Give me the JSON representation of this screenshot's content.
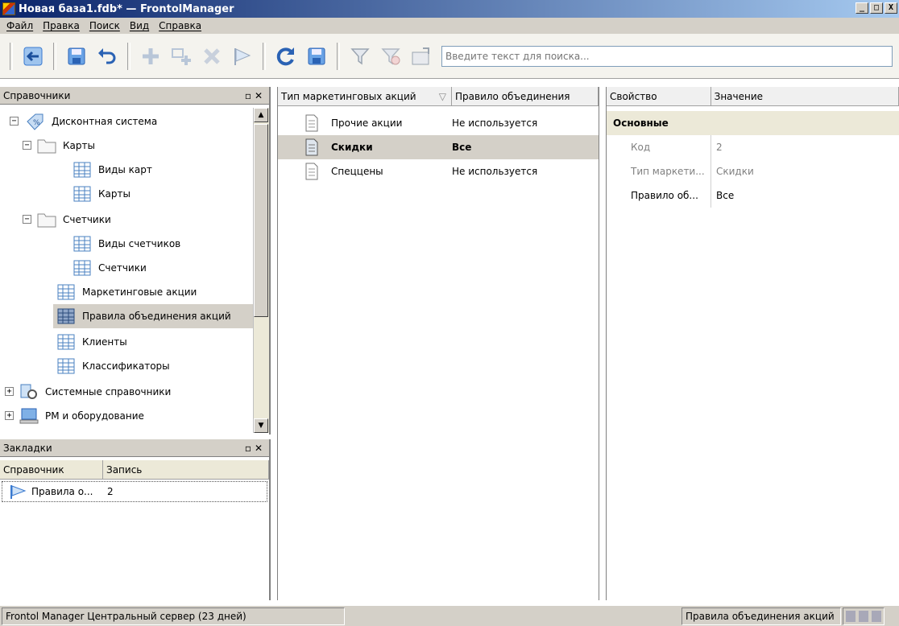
{
  "window": {
    "title": "Новая база1.fdb* — FrontolManager",
    "min_label": "_",
    "max_label": "□",
    "close_label": "X"
  },
  "menu": [
    "Файл",
    "Правка",
    "Поиск",
    "Вид",
    "Справка"
  ],
  "toolbar": {
    "search_placeholder": "Введите текст для поиска...",
    "buttons": [
      "back-arrow-icon",
      "save-icon",
      "undo-icon",
      "add-icon",
      "copy-add-icon",
      "delete-icon",
      "bookmark-flag-icon",
      "refresh-icon",
      "save-all-icon",
      "filter-icon",
      "filter-clear-icon",
      "export-icon"
    ]
  },
  "tree_panel": {
    "title": "Справочники",
    "items": [
      {
        "label": "Дисконтная система",
        "expander": "−"
      },
      {
        "label": "Карты",
        "expander": "−"
      },
      {
        "label": "Виды карт"
      },
      {
        "label": "Карты"
      },
      {
        "label": "Счетчики",
        "expander": "−"
      },
      {
        "label": "Виды счетчиков"
      },
      {
        "label": "Счетчики"
      },
      {
        "label": "Маркетинговые акции"
      },
      {
        "label": "Правила объединения акций"
      },
      {
        "label": "Клиенты"
      },
      {
        "label": "Классификаторы"
      },
      {
        "label": "Системные справочники",
        "expander": "+"
      },
      {
        "label": "РМ и оборудование",
        "expander": "+"
      }
    ]
  },
  "bookmarks_panel": {
    "title": "Закладки",
    "columns": [
      "Справочник",
      "Запись"
    ],
    "rows": [
      {
        "ref": "Правила о...",
        "record": "2"
      }
    ]
  },
  "grid": {
    "columns": [
      "Тип маркетинговых акций",
      "Правило объединения"
    ],
    "sort_indicator": "▽",
    "rows": [
      {
        "type": "Прочие акции",
        "rule": "Не используется"
      },
      {
        "type": "Скидки",
        "rule": "Все"
      },
      {
        "type": "Спеццены",
        "rule": "Не используется"
      }
    ]
  },
  "properties": {
    "columns": [
      "Свойство",
      "Значение"
    ],
    "group": "Основные",
    "rows": [
      {
        "key": "Код",
        "value": "2"
      },
      {
        "key": "Тип маркети...",
        "value": "Скидки"
      },
      {
        "key": "Правило об...",
        "value": "Все"
      }
    ]
  },
  "status": {
    "left": "Frontol Manager Центральный сервер (23 дней)",
    "right": "Правила объединения акций"
  },
  "colors": {
    "title_start": "#0a246a",
    "title_end": "#a6caf0",
    "selection": "#d4d0c8",
    "toolbar_icon_blue": "#3a7ad0"
  }
}
